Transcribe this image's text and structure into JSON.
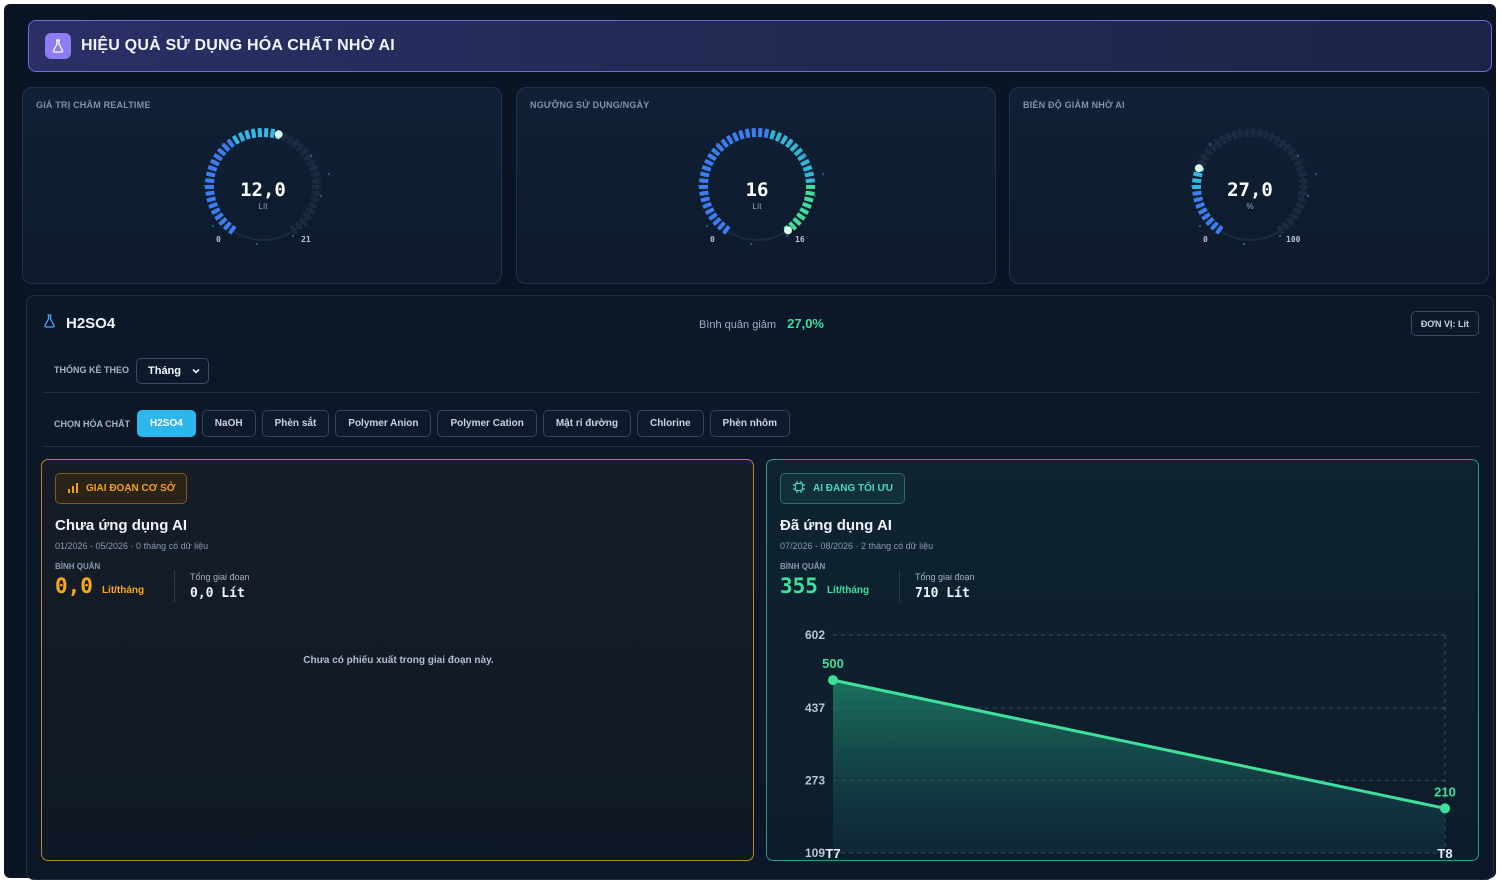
{
  "header": {
    "title": "HIỆU QUẢ SỬ DỤNG HÓA CHẤT NHỜ AI"
  },
  "gauges": [
    {
      "label": "GIÁ TRỊ CHÂM REALTIME",
      "value": "12,0",
      "unit": "Lít",
      "min": "0",
      "max": "21",
      "fraction": 0.57,
      "color": "#3f7cf0"
    },
    {
      "label": "NGƯỠNG SỬ DỤNG/NGÀY",
      "value": "16",
      "unit": "Lít",
      "min": "0",
      "max": "16",
      "fraction": 1.0,
      "color": "#3fe09b"
    },
    {
      "label": "BIÊN ĐỘ GIẢM NHỜ AI",
      "value": "27,0",
      "unit": "%",
      "min": "0",
      "max": "100",
      "fraction": 0.27,
      "color": "#3f7cf0"
    }
  ],
  "chemical": {
    "name": "H2SO4",
    "avg_label": "Bình quân giảm",
    "avg_value": "27,0%",
    "unit_button": "ĐƠN VỊ: Lít"
  },
  "filters": {
    "stat_label": "THỐNG KÊ THEO",
    "stat_value": "Tháng",
    "chem_label": "CHỌN HÓA CHẤT",
    "chips": [
      "H2SO4",
      "NaOH",
      "Phèn sắt",
      "Polymer Anion",
      "Polymer Cation",
      "Mật rỉ đường",
      "Chlorine",
      "Phèn nhôm"
    ],
    "active_index": 0
  },
  "base_panel": {
    "badge": "GIAI ĐOẠN CƠ SỞ",
    "title": "Chưa ứng dụng AI",
    "subtitle": "01/2026 - 05/2026 · 0 tháng có dữ liệu",
    "avg_label": "BÌNH QUÂN",
    "avg_value": "0,0",
    "avg_unit": "Lít/tháng",
    "total_label": "Tổng giai đoạn",
    "total_value": "0,0 Lít",
    "empty_message": "Chưa có phiếu xuất trong giai đoạn này."
  },
  "ai_panel": {
    "badge": "AI ĐANG TỐI ƯU",
    "title": "Đã ứng dụng AI",
    "subtitle": "07/2026 - 08/2026 · 2 tháng có dữ liệu",
    "avg_label": "BÌNH QUÂN",
    "avg_value": "355",
    "avg_unit": "Lít/tháng",
    "total_label": "Tổng giai đoạn",
    "total_value": "710 Lít"
  },
  "chart_data": {
    "type": "area",
    "categories": [
      "T7",
      "T8"
    ],
    "values": [
      500,
      210
    ],
    "y_ticks": [
      602,
      437,
      273,
      109
    ],
    "ylim": [
      109,
      602
    ],
    "grid": true,
    "color": "#3fe09b"
  }
}
